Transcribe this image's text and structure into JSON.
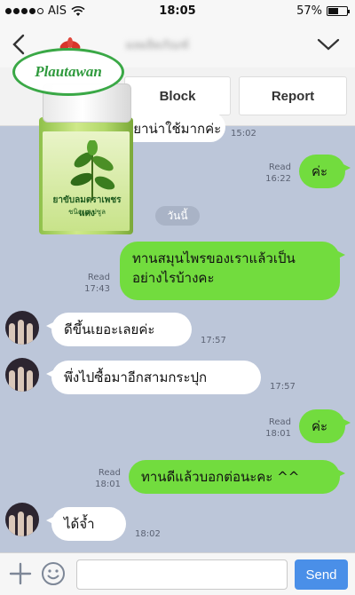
{
  "status_bar": {
    "carrier": "AIS",
    "time": "18:05",
    "battery_percent": "57%",
    "battery_level": 0.57,
    "signal_bars_filled": 4,
    "signal_bars_total": 5
  },
  "header": {
    "chat_name": "ผลผลิตภัณฑ์"
  },
  "actions": {
    "block_label": "Block",
    "report_label": "Report"
  },
  "brand": {
    "name": "Plautawan",
    "product_name": "ยาขับลมตราเพชรแดง",
    "product_sub": "ชนิดแคปซูล"
  },
  "messages": [
    {
      "dir": "in",
      "text": "...ผลิตภัณฑ์ยาน่าใช้มากค่ะ",
      "time": "15:02"
    },
    {
      "dir": "out",
      "text": "ค่ะ",
      "read": "Read",
      "time": "16:22"
    },
    {
      "dir": "date",
      "text": "วันนี้"
    },
    {
      "dir": "out",
      "text_line1": "ทานสมุนไพรของเราแล้วเป็น",
      "text_line2": "อย่างไรบ้างคะ",
      "read": "Read",
      "time": "17:43"
    },
    {
      "dir": "in",
      "text": "ดีขึ้นเยอะเลยค่ะ",
      "time": "17:57"
    },
    {
      "dir": "in",
      "text": "พึ่งไปซื้อมาอีกสามกระปุก",
      "time": "17:57"
    },
    {
      "dir": "out",
      "text": "ค่ะ",
      "read": "Read",
      "time": "18:01"
    },
    {
      "dir": "out",
      "text": "ทานดีแล้วบอกต่อนะคะ ^^",
      "read": "Read",
      "time": "18:01"
    },
    {
      "dir": "in",
      "text": "ได้จ้ำ",
      "time": "18:02"
    }
  ],
  "input": {
    "placeholder": "",
    "send_label": "Send"
  }
}
